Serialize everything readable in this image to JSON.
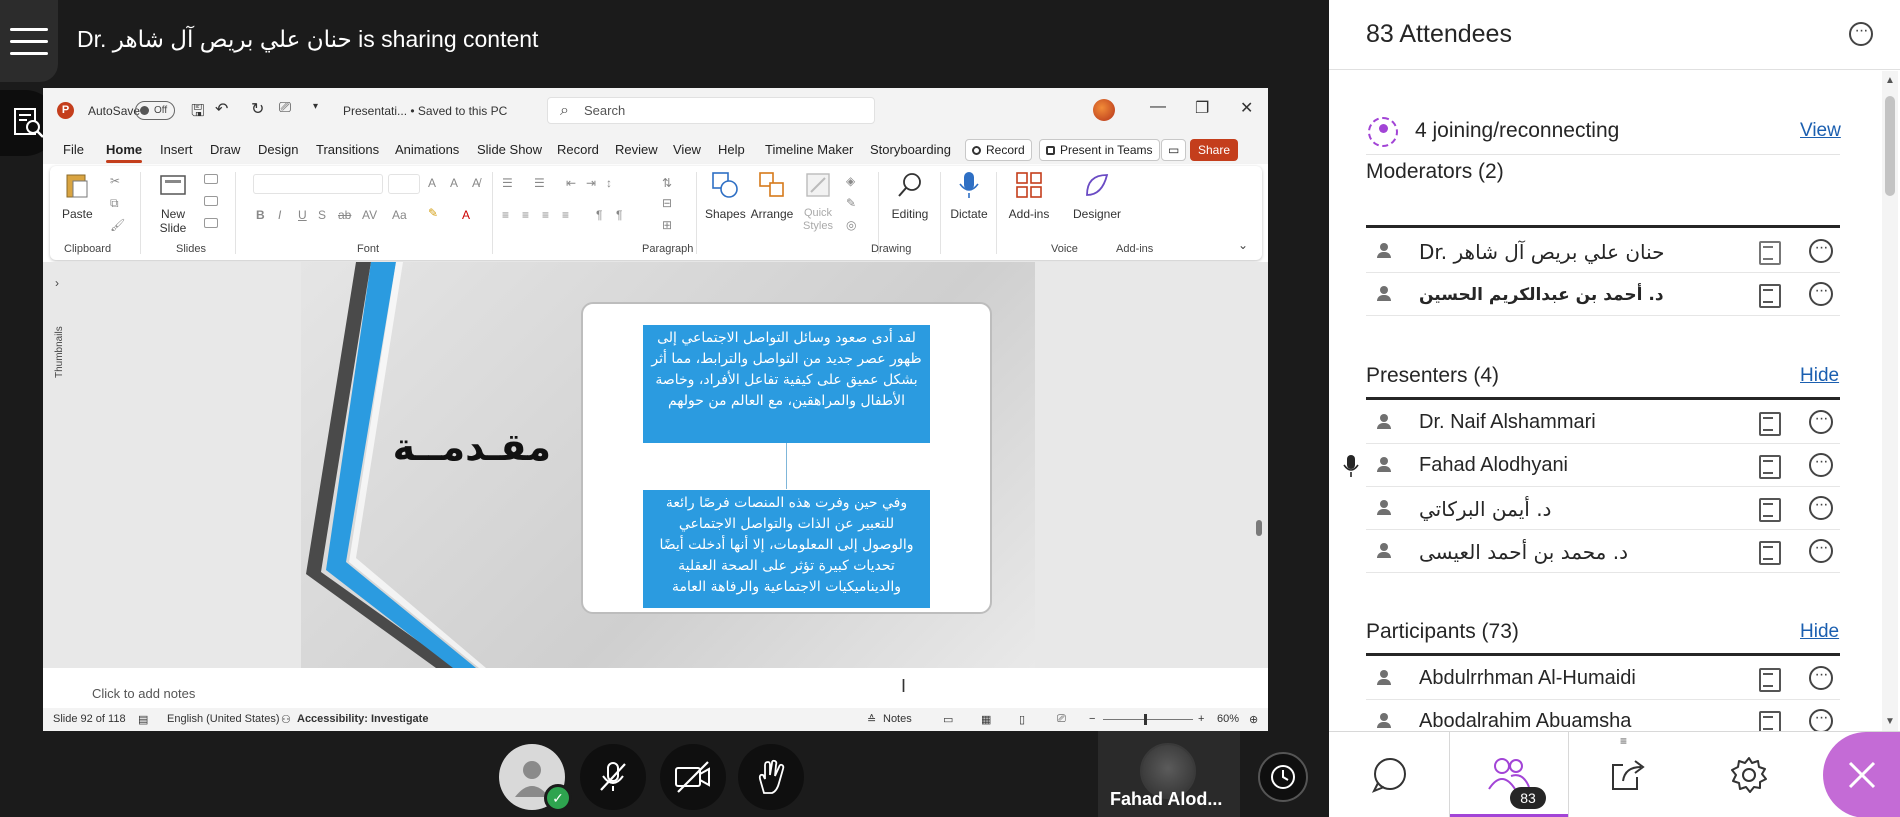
{
  "meeting": {
    "share_title": "Dr. حنان علي بريص آل شاهر is sharing content"
  },
  "powerpoint": {
    "autosave_label": "AutoSave",
    "autosave_state": "Off",
    "doc_title": "Presentati... • Saved to this PC",
    "search_placeholder": "Search",
    "tabs": [
      "File",
      "Home",
      "Insert",
      "Draw",
      "Design",
      "Transitions",
      "Animations",
      "Slide Show",
      "Record",
      "Review",
      "View",
      "Help",
      "Timeline Maker",
      "Storyboarding"
    ],
    "record_btn": "Record",
    "present_teams_btn": "Present in Teams",
    "share_btn": "Share",
    "ribbon": {
      "paste": "Paste",
      "new_slide": "New Slide",
      "shapes": "Shapes",
      "arrange": "Arrange",
      "quick_styles": "Quick Styles",
      "editing": "Editing",
      "dictate": "Dictate",
      "addins": "Add-ins",
      "designer": "Designer",
      "group_labels": [
        "Clipboard",
        "Slides",
        "Font",
        "Paragraph",
        "Drawing",
        "Voice",
        "Add-ins"
      ]
    },
    "thumbnails_label": "Thumbnails",
    "slide": {
      "title": "مقـدمــة",
      "box1": "لقد أدى صعود وسائل التواصل الاجتماعي إلى ظهور عصر جديد من التواصل والترابط، مما أثر بشكل عميق على كيفية تفاعل الأفراد، وخاصة الأطفال والمراهقين، مع العالم من حولهم",
      "box2": "وفي حين وفرت هذه المنصات فرصًا رائعة للتعبير عن الذات والتواصل الاجتماعي والوصول إلى المعلومات، إلا أنها أدخلت أيضًا تحديات كبيرة تؤثر على الصحة العقلية والديناميكيات الاجتماعية والرفاهة العامة"
    },
    "notes_placeholder": "Click to add notes",
    "status": {
      "slide_count": "Slide 92 of 118",
      "language": "English (United States)",
      "accessibility": "Accessibility: Investigate",
      "notes": "Notes",
      "zoom": "60%"
    }
  },
  "bottom_bar": {
    "video_name": "Fahad Alod..."
  },
  "panel": {
    "title": "83 Attendees",
    "joining": "4 joining/reconnecting",
    "joining_link": "View",
    "moderators_title": "Moderators (2)",
    "moderators": [
      "Dr. حنان علي بريص آل شاهر",
      "د. أحمد بن عبدالكريم الحسين"
    ],
    "presenters_title": "Presenters (4)",
    "presenters_link": "Hide",
    "presenters": [
      "Dr. Naif Alshammari",
      "Fahad Alodhyani",
      "د. أيمن البركاتي",
      "د. محمد بن أحمد العيسى"
    ],
    "participants_title": "Participants (73)",
    "participants_link": "Hide",
    "participants": [
      "Abdulrrhman Al-Humaidi",
      "Abodalrahim Abuamsha"
    ],
    "people_count": "83"
  }
}
